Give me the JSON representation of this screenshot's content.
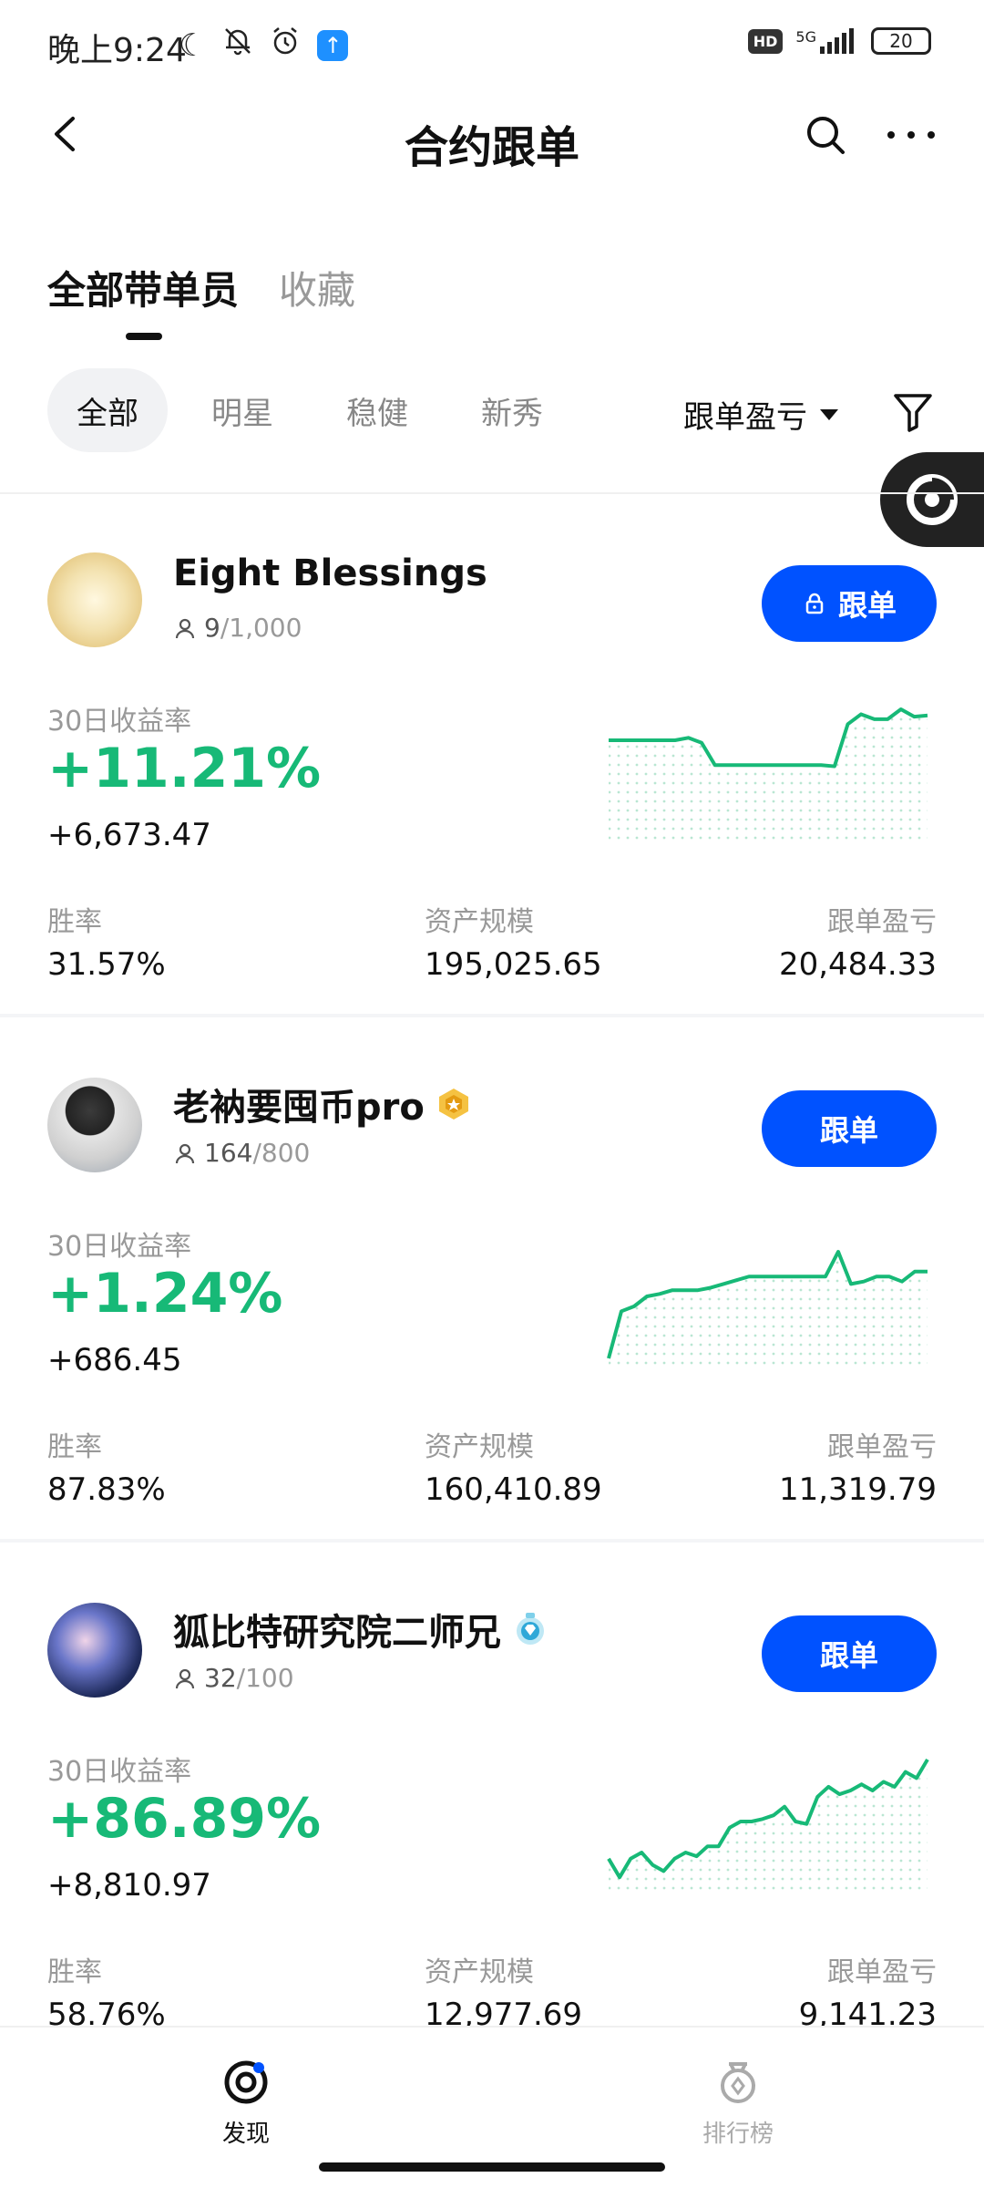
{
  "status_bar": {
    "time": "晚上9:24",
    "network": "5G",
    "hd": "HD",
    "battery": "20"
  },
  "nav": {
    "title": "合约跟单"
  },
  "main_tabs": [
    {
      "label": "全部带单员",
      "active": true
    },
    {
      "label": "收藏",
      "active": false
    }
  ],
  "filter_chips": [
    {
      "label": "全部",
      "active": true
    },
    {
      "label": "明星",
      "active": false
    },
    {
      "label": "稳健",
      "active": false
    },
    {
      "label": "新秀",
      "active": false
    }
  ],
  "sort": {
    "label": "跟单盈亏"
  },
  "traders": [
    {
      "name": "Eight Blessings",
      "followers": "9",
      "max_followers": "/1,000",
      "locked": true,
      "follow_label": "跟单",
      "roi_label": "30日收益率",
      "roi": "+11.21%",
      "pnl": "+6,673.47",
      "win_rate_label": "胜率",
      "win_rate": "31.57%",
      "aum_label": "资产规模",
      "aum": "195,025.65",
      "copy_pnl_label": "跟单盈亏",
      "copy_pnl": "20,484.33",
      "badge": null,
      "spark": [
        0.75,
        0.75,
        0.75,
        0.75,
        0.75,
        0.75,
        0.77,
        0.73,
        0.55,
        0.55,
        0.55,
        0.55,
        0.55,
        0.55,
        0.55,
        0.55,
        0.55,
        0.54,
        0.88,
        0.96,
        0.92,
        0.92,
        1.0,
        0.94,
        0.95
      ]
    },
    {
      "name": "老衲要囤币pro",
      "followers": "164",
      "max_followers": "/800",
      "locked": false,
      "follow_label": "跟单",
      "roi_label": "30日收益率",
      "roi": "+1.24%",
      "pnl": "+686.45",
      "win_rate_label": "胜率",
      "win_rate": "87.83%",
      "aum_label": "资产规模",
      "aum": "160,410.89",
      "copy_pnl_label": "跟单盈亏",
      "copy_pnl": "11,319.79",
      "badge": "gold-medal",
      "spark": [
        0.0,
        0.38,
        0.42,
        0.5,
        0.52,
        0.55,
        0.55,
        0.55,
        0.57,
        0.6,
        0.63,
        0.66,
        0.66,
        0.66,
        0.66,
        0.66,
        0.66,
        0.66,
        0.86,
        0.6,
        0.62,
        0.66,
        0.66,
        0.62,
        0.7,
        0.7
      ]
    },
    {
      "name": "狐比特研究院二师兄",
      "followers": "32",
      "max_followers": "/100",
      "locked": false,
      "follow_label": "跟单",
      "roi_label": "30日收益率",
      "roi": "+86.89%",
      "pnl": "+8,810.97",
      "win_rate_label": "胜率",
      "win_rate": "58.76%",
      "aum_label": "资产规模",
      "aum": "12,977.69",
      "copy_pnl_label": "跟单盈亏",
      "copy_pnl": "9,141.23",
      "badge": "diamond-medal",
      "spark": [
        0.2,
        0.05,
        0.2,
        0.25,
        0.15,
        0.1,
        0.2,
        0.25,
        0.22,
        0.3,
        0.3,
        0.45,
        0.5,
        0.5,
        0.52,
        0.55,
        0.62,
        0.5,
        0.48,
        0.7,
        0.78,
        0.72,
        0.75,
        0.8,
        0.75,
        0.82,
        0.78,
        0.9,
        0.85,
        1.0
      ]
    }
  ],
  "bottom_nav": [
    {
      "label": "发现",
      "icon": "discover-icon",
      "active": true
    },
    {
      "label": "排行榜",
      "icon": "leaderboard-icon",
      "active": false
    }
  ],
  "colors": {
    "accent": "#0052ff",
    "positive": "#17b977",
    "float_bg": "#222222"
  }
}
